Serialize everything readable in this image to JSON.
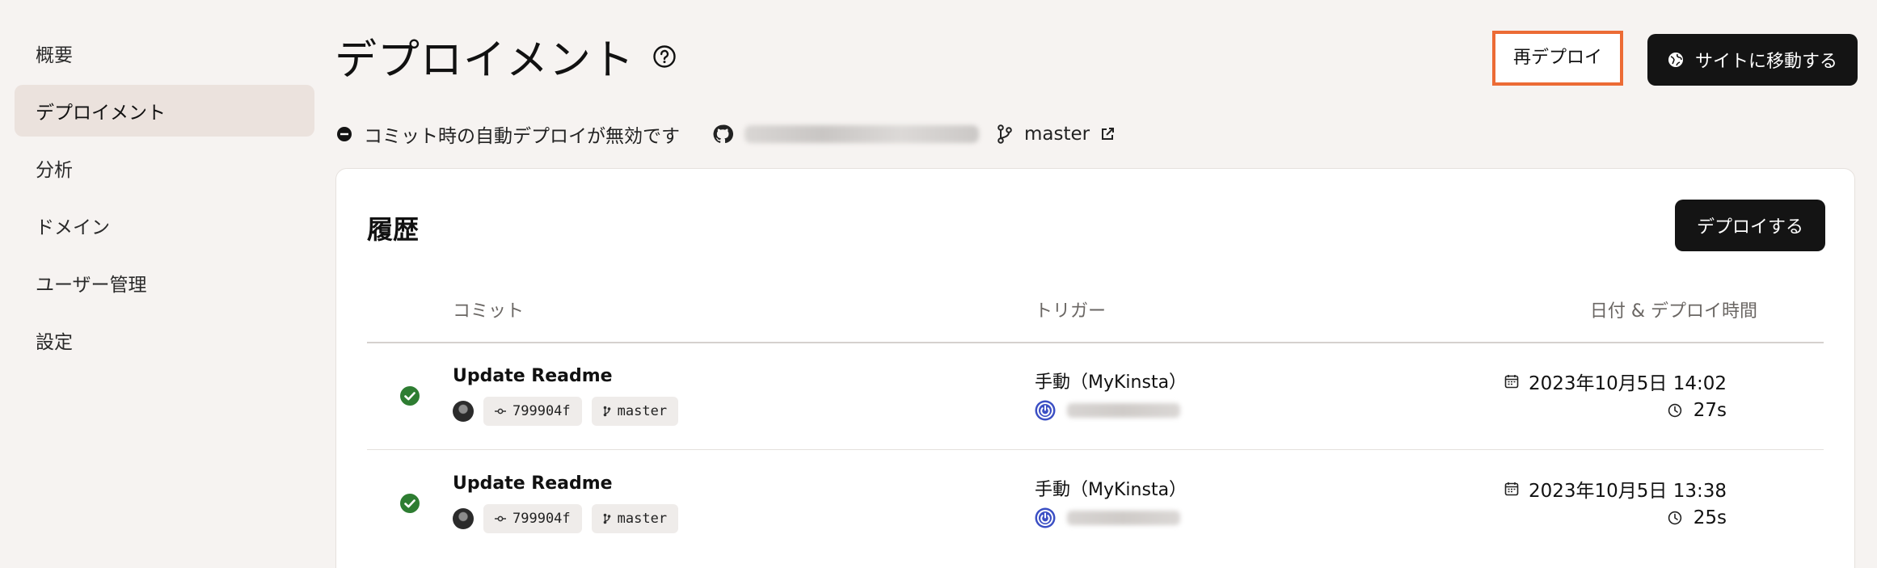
{
  "sidebar": {
    "items": [
      {
        "label": "概要"
      },
      {
        "label": "デプロイメント",
        "active": true
      },
      {
        "label": "分析"
      },
      {
        "label": "ドメイン"
      },
      {
        "label": "ユーザー管理"
      },
      {
        "label": "設定"
      }
    ]
  },
  "header": {
    "title": "デプロイメント",
    "redeploy_label": "再デプロイ",
    "visit_label": "サイトに移動する",
    "accent_color": "#ec6b35"
  },
  "info": {
    "auto_deploy_text": "コミット時の自動デプロイが無効です",
    "branch": "master"
  },
  "history": {
    "title": "履歴",
    "deploy_label": "デプロイする",
    "columns": {
      "commit": "コミット",
      "trigger": "トリガー",
      "date": "日付 & デプロイ時間"
    },
    "rows": [
      {
        "status": "success",
        "message": "Update Readme",
        "hash": "799904f",
        "branch": "master",
        "trigger": "手動（MyKinsta）",
        "date": "2023年10月5日 14:02",
        "duration": "27s"
      },
      {
        "status": "success",
        "message": "Update Readme",
        "hash": "799904f",
        "branch": "master",
        "trigger": "手動（MyKinsta）",
        "date": "2023年10月5日 13:38",
        "duration": "25s"
      }
    ]
  }
}
